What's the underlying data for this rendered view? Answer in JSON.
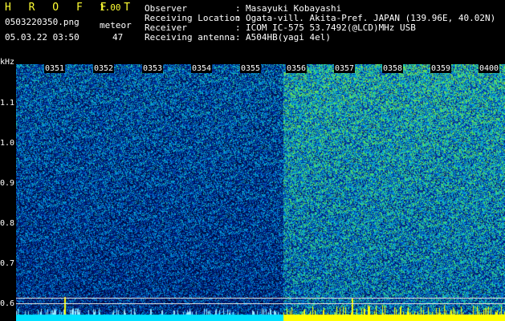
{
  "app": {
    "title": "H R O F F T",
    "version": "1.00"
  },
  "file": {
    "name": "0503220350.png",
    "timestamp": "05.03.22 03:50"
  },
  "counter": {
    "label": "meteor",
    "value": "47"
  },
  "info": [
    {
      "label": "Observer",
      "value": "Masayuki Kobayashi"
    },
    {
      "label": "Receiving Location",
      "value": "Ogata-vill. Akita-Pref. JAPAN (139.96E, 40.02N)"
    },
    {
      "label": "Receiver",
      "value": "ICOM IC-575 53.7492(@LCD)MHz USB"
    },
    {
      "label": "Receiving antenna",
      "value": "A504HB(yagi 4el)"
    }
  ],
  "separator": ":",
  "axis": {
    "y_unit": "kHz",
    "y_ticks": [
      "1.1",
      "1.0",
      "0.9",
      "0.8",
      "0.7",
      "0.6"
    ],
    "x_ticks": [
      "0351",
      "0352",
      "0353",
      "0354",
      "0355",
      "0356",
      "0357",
      "0358",
      "0359",
      "0400"
    ]
  },
  "colors": {
    "bg": "#000000",
    "title": "#ffff33",
    "text": "#ffffff",
    "spectrum_low": "#0b1a6e",
    "spectrum_mid": "#1e66d0",
    "spectrum_high": "#5fd86a",
    "baseline": "#ffff00",
    "baseline_left": "#00e0ff"
  }
}
